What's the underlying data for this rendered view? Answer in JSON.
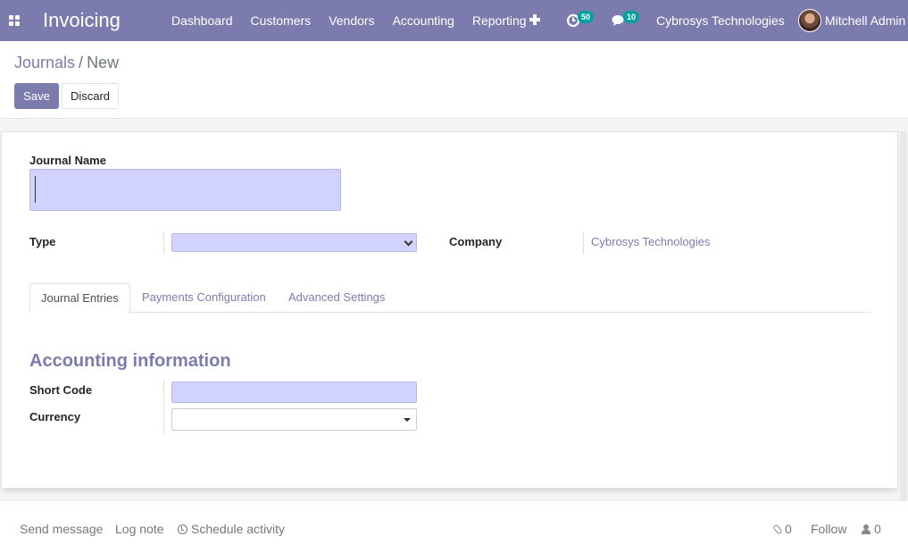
{
  "navbar": {
    "app_title": "Invoicing",
    "menu": [
      "Dashboard",
      "Customers",
      "Vendors",
      "Accounting",
      "Reporting"
    ],
    "activity_count": "50",
    "message_count": "10",
    "company": "Cybrosys Technologies",
    "user": "Mitchell Admin",
    "icons": [
      "apps-grid-icon",
      "plus-icon",
      "activity-clock-icon",
      "chat-icon",
      "avatar"
    ],
    "colors": {
      "brand": "#7c7bad",
      "badge": "#00a09d"
    }
  },
  "control_panel": {
    "breadcrumb": {
      "parent": "Journals",
      "separator": "/",
      "current": "New"
    },
    "save_label": "Save",
    "discard_label": "Discard"
  },
  "form": {
    "journal_name_label": "Journal Name",
    "journal_name_value": "",
    "type_label": "Type",
    "type_value": "",
    "company_label": "Company",
    "company_value": "Cybrosys Technologies",
    "tabs": [
      "Journal Entries",
      "Payments Configuration",
      "Advanced Settings"
    ],
    "active_tab": "Journal Entries",
    "section_title": "Accounting information",
    "short_code_label": "Short Code",
    "short_code_value": "",
    "currency_label": "Currency",
    "currency_value": "",
    "colors": {
      "required_field": "#d2d2ff",
      "link": "#7c7bad"
    }
  },
  "chatter": {
    "send_message": "Send message",
    "log_note": "Log note",
    "schedule_activity": "Schedule activity",
    "attachments_count": "0",
    "follow": "Follow",
    "followers_count": "0"
  }
}
